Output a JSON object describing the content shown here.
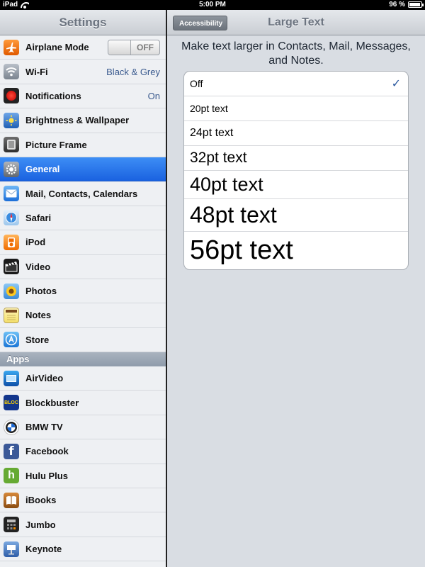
{
  "statusbar": {
    "device": "iPad",
    "time": "5:00 PM",
    "battery": "96 %"
  },
  "left": {
    "title": "Settings",
    "items": [
      {
        "label": "Airplane Mode",
        "toggle": "OFF"
      },
      {
        "label": "Wi-Fi",
        "value": "Black & Grey"
      },
      {
        "label": "Notifications",
        "value": "On"
      },
      {
        "label": "Brightness & Wallpaper"
      },
      {
        "label": "Picture Frame"
      },
      {
        "label": "General"
      },
      {
        "label": "Mail, Contacts, Calendars"
      },
      {
        "label": "Safari"
      },
      {
        "label": "iPod"
      },
      {
        "label": "Video"
      },
      {
        "label": "Photos"
      },
      {
        "label": "Notes"
      },
      {
        "label": "Store"
      }
    ],
    "apps_header": "Apps",
    "apps": [
      {
        "label": "AirVideo"
      },
      {
        "label": "Blockbuster",
        "icon_text": "BLOC"
      },
      {
        "label": "BMW TV"
      },
      {
        "label": "Facebook",
        "icon_text": "f"
      },
      {
        "label": "Hulu Plus",
        "icon_text": "h"
      },
      {
        "label": "iBooks"
      },
      {
        "label": "Jumbo"
      },
      {
        "label": "Keynote"
      }
    ]
  },
  "right": {
    "back_label": "Accessibility",
    "title": "Large Text",
    "description": "Make text larger in Contacts, Mail, Messages, and Notes.",
    "options": [
      {
        "label": "Off",
        "selected": true
      },
      {
        "label": "20pt text"
      },
      {
        "label": "24pt text"
      },
      {
        "label": "32pt text"
      },
      {
        "label": "40pt text"
      },
      {
        "label": "48pt text"
      },
      {
        "label": "56pt text"
      }
    ],
    "check_glyph": "✓"
  },
  "colors": {
    "selected": "#1a62e0",
    "value_text": "#3a5a8e",
    "check": "#2c5aa0"
  }
}
